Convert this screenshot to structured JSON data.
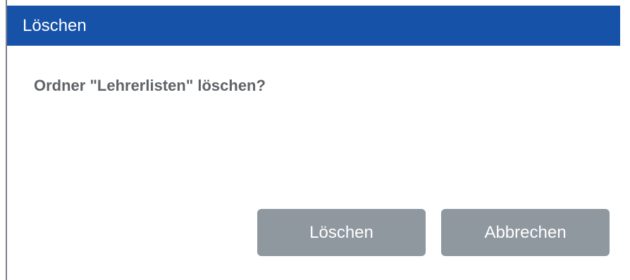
{
  "dialog": {
    "title": "Löschen",
    "message": "Ordner \"Lehrerlisten\" löschen?",
    "buttons": {
      "delete_label": "Löschen",
      "cancel_label": "Abbrechen"
    }
  },
  "colors": {
    "titlebar": "#1552a8",
    "button": "#8f979f",
    "message_text": "#5f6368"
  }
}
